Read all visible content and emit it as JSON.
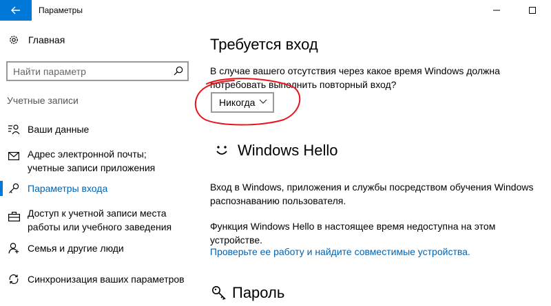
{
  "window": {
    "title": "Параметры"
  },
  "sidebar": {
    "home_label": "Главная",
    "search_placeholder": "Найти параметр",
    "section_label": "Учетные записи",
    "items": [
      {
        "label": "Ваши данные",
        "icon": "person-list-icon",
        "active": false
      },
      {
        "label": "Адрес электронной почты; учетные записи приложения",
        "icon": "mail-icon",
        "active": false
      },
      {
        "label": "Параметры входа",
        "icon": "key-icon",
        "active": true
      },
      {
        "label": "Доступ к учетной записи места работы или учебного заведения",
        "icon": "briefcase-icon",
        "active": false
      },
      {
        "label": "Семья и другие люди",
        "icon": "people-icon",
        "active": false
      },
      {
        "label": "Синхронизация ваших параметров",
        "icon": "sync-icon",
        "active": false
      }
    ]
  },
  "main": {
    "signin_title": "Требуется вход",
    "signin_question": "В случае вашего отсутствия через какое время Windows должна потребовать выполнить повторный вход?",
    "signin_dropdown_value": "Никогда",
    "hello_title": "Windows Hello",
    "hello_desc": "Вход в Windows, приложения и службы посредством обучения Windows распознаванию пользователя.",
    "hello_unavailable": "Функция Windows Hello в настоящее время недоступна на этом устройстве.",
    "hello_link": "Проверьте ее работу и найдите совместимые устройства.",
    "password_title": "Пароль"
  },
  "colors": {
    "accent": "#0078d7",
    "link": "#0063b1",
    "annotation": "#e8141c"
  }
}
